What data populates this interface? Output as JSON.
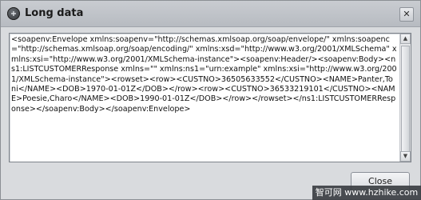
{
  "window": {
    "title": "Long data",
    "close_glyph": "✕",
    "icon": "app-badge-icon"
  },
  "content": {
    "text": "<soapenv:Envelope xmlns:soapenv=\"http://schemas.xmlsoap.org/soap/envelope/\" xmlns:soapenc=\"http://schemas.xmlsoap.org/soap/encoding/\" xmlns:xsd=\"http://www.w3.org/2001/XMLSchema\" xmlns:xsi=\"http://www.w3.org/2001/XMLSchema-instance\"><soapenv:Header/><soapenv:Body><ns1:LISTCUSTOMERResponse xmlns=\"\" xmlns:ns1=\"urn:example\" xmlns:xsi=\"http://www.w3.org/2001/XMLSchema-instance\"><rowset><row><CUSTNO>36505633552</CUSTNO><NAME>Panter,Toni</NAME><DOB>1970-01-01Z</DOB></row><row><CUSTNO>36533219101</CUSTNO><NAME>Poesie,Charo</NAME><DOB>1990-01-01Z</DOB></row></rowset></ns1:LISTCUSTOMERResponse></soapenv:Body></soapenv:Envelope>"
  },
  "buttons": {
    "close_label": "Close"
  },
  "watermark": {
    "text": "智可网 www.hzhike.com"
  },
  "scrollbar": {
    "up_glyph": "▲",
    "down_glyph": "▼"
  }
}
